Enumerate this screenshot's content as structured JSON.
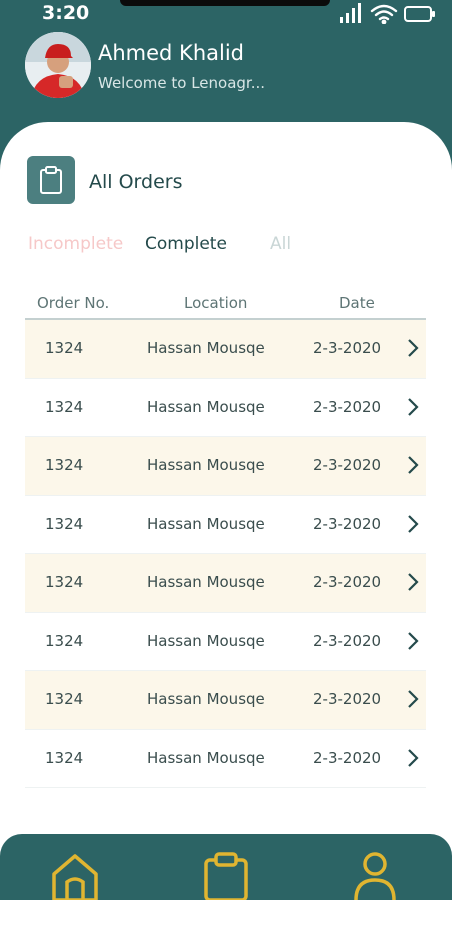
{
  "status_bar": {
    "time": "3:20"
  },
  "header": {
    "user_name": "Ahmed Khalid",
    "welcome_text": "Welcome to Lenoagr..."
  },
  "section": {
    "title": "All Orders"
  },
  "tabs": [
    {
      "label": "Incomplete"
    },
    {
      "label": "Complete"
    },
    {
      "label": "All"
    }
  ],
  "table": {
    "headers": [
      "Order No.",
      "Location",
      "Date"
    ],
    "rows": [
      {
        "order_no": "1324",
        "location": "Hassan Mousqe",
        "date": "2-3-2020"
      },
      {
        "order_no": "1324",
        "location": "Hassan Mousqe",
        "date": "2-3-2020"
      },
      {
        "order_no": "1324",
        "location": "Hassan Mousqe",
        "date": "2-3-2020"
      },
      {
        "order_no": "1324",
        "location": "Hassan Mousqe",
        "date": "2-3-2020"
      },
      {
        "order_no": "1324",
        "location": "Hassan Mousqe",
        "date": "2-3-2020"
      },
      {
        "order_no": "1324",
        "location": "Hassan Mousqe",
        "date": "2-3-2020"
      },
      {
        "order_no": "1324",
        "location": "Hassan Mousqe",
        "date": "2-3-2020"
      },
      {
        "order_no": "1324",
        "location": "Hassan Mousqe",
        "date": "2-3-2020"
      }
    ]
  },
  "bottom_nav": {
    "items": [
      {
        "icon": "home-icon"
      },
      {
        "icon": "clipboard-icon"
      },
      {
        "icon": "user-icon"
      }
    ]
  },
  "colors": {
    "primary": "#2c6465",
    "accent": "#e0b531",
    "row_alt": "#fcf7ea",
    "tab_incomplete": "#f6c8c8"
  }
}
